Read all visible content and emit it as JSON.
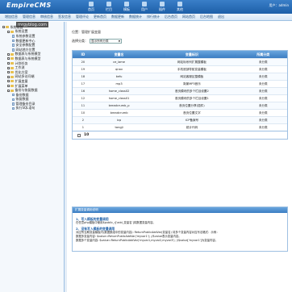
{
  "header": {
    "logo": "EmpireCMS",
    "nav_tabs": [
      {
        "label": "首页",
        "icon": "home-icon"
      },
      {
        "label": "栏目",
        "icon": "column-icon"
      },
      {
        "label": "模板",
        "icon": "template-icon"
      },
      {
        "label": "用户",
        "icon": "user-icon"
      },
      {
        "label": "插件",
        "icon": "plugin-icon"
      },
      {
        "label": "其他",
        "icon": "other-icon"
      }
    ],
    "user": "用户：admin"
  },
  "subnav": [
    "增加信息",
    "管理信息",
    "审核信息",
    "签发信息",
    "管理评论",
    "更新首页",
    "数据更新",
    "数据统计",
    "排行统计",
    "后台首页",
    "网站首页",
    "后台地图",
    "退出"
  ],
  "sidebar": {
    "watermark": "mrgyblog.com",
    "items": [
      {
        "label": "系统设置",
        "level": 1,
        "kind": "folder",
        "box": "−"
      },
      {
        "label": "系统设置",
        "level": 2,
        "kind": "folder",
        "box": "−"
      },
      {
        "label": "系统参数设置",
        "level": 3,
        "kind": "doc"
      },
      {
        "label": "数据更新中心",
        "level": 3,
        "kind": "doc"
      },
      {
        "label": "安全参数配置",
        "level": 3,
        "kind": "doc"
      },
      {
        "label": "网站地方位置",
        "level": 3,
        "kind": "doc"
      },
      {
        "label": "数据表与系统模型",
        "level": 2,
        "kind": "folder",
        "box": "+"
      },
      {
        "label": "数据表与系统模型",
        "level": 2,
        "kind": "folder",
        "box": "+"
      },
      {
        "label": "计划任务",
        "level": 2,
        "kind": "folder",
        "box": "+"
      },
      {
        "label": "工作流",
        "level": 2,
        "kind": "folder",
        "box": "+"
      },
      {
        "label": "优化方案",
        "level": 2,
        "kind": "folder",
        "box": "+"
      },
      {
        "label": "网站多访问端",
        "level": 2,
        "kind": "folder",
        "box": "+"
      },
      {
        "label": "扩展变量",
        "level": 2,
        "kind": "folder",
        "box": "+"
      },
      {
        "label": "扩展菜单",
        "level": 2,
        "kind": "folder",
        "box": "+"
      },
      {
        "label": "备份与恢复数据",
        "level": 2,
        "kind": "folder",
        "box": "−"
      },
      {
        "label": "备份数据",
        "level": 3,
        "kind": "doc"
      },
      {
        "label": "恢复数据",
        "level": 3,
        "kind": "doc"
      },
      {
        "label": "管理备份目录",
        "level": 3,
        "kind": "doc"
      },
      {
        "label": "执行SQL语句",
        "level": 3,
        "kind": "doc"
      }
    ]
  },
  "main": {
    "breadcrumb": "位置：管理扩展变量",
    "filter_label": "选择分类：",
    "filter_value": "显示所有分类",
    "table": {
      "headers": [
        "ID",
        "变量名",
        "变量标识",
        "所属分类"
      ],
      "rows": [
        [
          "20",
          "ce_lame",
          "网站标系列扩展整模板",
          "未分类"
        ],
        [
          "19",
          "qnav",
          "手机底部导航变量模板",
          "未分类"
        ],
        [
          "18",
          "kefu",
          "网站客服区整模板",
          "未分类"
        ],
        [
          "17",
          "mp3",
          "背景MP3音乐",
          "未分类"
        ],
        [
          "16",
          "home_class02",
          "首页模块的多个栏目设置2",
          "未分类"
        ],
        [
          "12",
          "home_class01",
          "首页模块的多个栏目设置1",
          "未分类"
        ],
        [
          "11",
          "breadcrumb_p",
          "首页位置分享(插件)",
          "未分类"
        ],
        [
          "10",
          "breadcrumb",
          "首页位置文字",
          "未分类"
        ],
        [
          "2",
          "icp",
          "ICP备案号",
          "未分类"
        ],
        [
          "1",
          "tongji",
          "统计代码",
          "未分类"
        ]
      ],
      "footer_num": "10"
    },
    "help": {
      "title": "扩展变量调用说明",
      "h1": "1、写入模板的变量调用",
      "l1": "在任意php模板中使用$public_r['add_变量名']将数据变量内容。",
      "h2": "2、没有写入模板的变量调用",
      "l2": "对应所当期变量模板内(数据数组中的变量内容): ReturnPublicAddVar(变量名) 将多个变量内容对应写法格式：示例：",
      "l3": "数据多变量内容: $value=ReturnPublicAddVar('myvar1'); //$value表示变量内容。",
      "l4": "数据多个变量内容: $value=ReturnPublicAddVar('myvar1,myvar2,myvar3'); //$value['myvar1']为变量内容。"
    }
  }
}
